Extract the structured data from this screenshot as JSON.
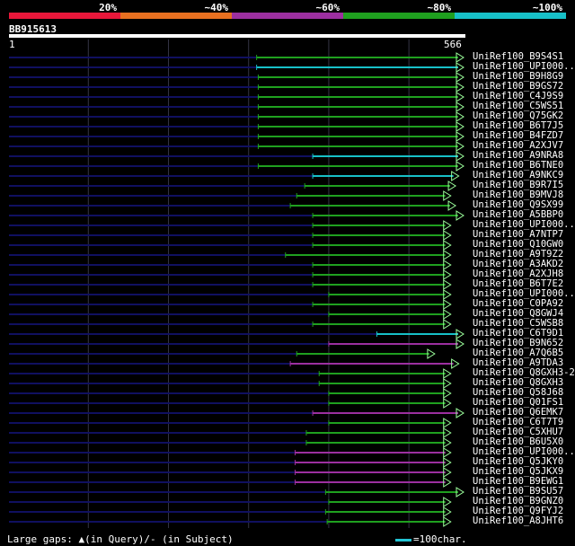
{
  "legend": [
    {
      "label": "20%",
      "color": "#e8173a"
    },
    {
      "label": "~40%",
      "color": "#e87020"
    },
    {
      "label": "~60%",
      "color": "#9c2fa0"
    },
    {
      "label": "~80%",
      "color": "#1fa01f"
    },
    {
      "label": "~100%",
      "color": "#17c0c8"
    }
  ],
  "query": {
    "id": "BB915613",
    "start": "1",
    "end": "566"
  },
  "colors": {
    "green": "#1fa01f",
    "cyan": "#17c0c8",
    "purple": "#9c2fa0",
    "navy": "#101060",
    "grid": "#333344"
  },
  "hits": [
    {
      "label": "UniRef100_B9S4S1",
      "color": "green",
      "start": 310,
      "end": 566
    },
    {
      "label": "UniRef100_UPI000..",
      "color": "cyan",
      "start": 310,
      "end": 566
    },
    {
      "label": "UniRef100_B9H8G9",
      "color": "green",
      "start": 312,
      "end": 566
    },
    {
      "label": "UniRef100_B9GS72",
      "color": "green",
      "start": 312,
      "end": 566
    },
    {
      "label": "UniRef100_C4J9S9",
      "color": "green",
      "start": 312,
      "end": 566
    },
    {
      "label": "UniRef100_C5WS51",
      "color": "green",
      "start": 312,
      "end": 566
    },
    {
      "label": "UniRef100_Q75GK2",
      "color": "green",
      "start": 312,
      "end": 566
    },
    {
      "label": "UniRef100_B6T7J5",
      "color": "green",
      "start": 312,
      "end": 566
    },
    {
      "label": "UniRef100_B4FZD7",
      "color": "green",
      "start": 312,
      "end": 566
    },
    {
      "label": "UniRef100_A2XJV7",
      "color": "green",
      "start": 312,
      "end": 566
    },
    {
      "label": "UniRef100_A9NRA8",
      "color": "cyan",
      "start": 380,
      "end": 566
    },
    {
      "label": "UniRef100_B6TNE0",
      "color": "green",
      "start": 312,
      "end": 566
    },
    {
      "label": "UniRef100_A9NKC9",
      "color": "cyan",
      "start": 380,
      "end": 560
    },
    {
      "label": "UniRef100_B9R7I5",
      "color": "green",
      "start": 370,
      "end": 556
    },
    {
      "label": "UniRef100_B9MVJ8",
      "color": "green",
      "start": 360,
      "end": 550
    },
    {
      "label": "UniRef100_Q9SX99",
      "color": "green",
      "start": 352,
      "end": 556
    },
    {
      "label": "UniRef100_A5BBP0",
      "color": "green",
      "start": 380,
      "end": 566
    },
    {
      "label": "UniRef100_UPI000..",
      "color": "green",
      "start": 380,
      "end": 550
    },
    {
      "label": "UniRef100_A7NTP7",
      "color": "green",
      "start": 380,
      "end": 550
    },
    {
      "label": "UniRef100_Q10GW0",
      "color": "green",
      "start": 380,
      "end": 550
    },
    {
      "label": "UniRef100_A9T9Z2",
      "color": "green",
      "start": 346,
      "end": 550
    },
    {
      "label": "UniRef100_A3AKD2",
      "color": "green",
      "start": 380,
      "end": 550
    },
    {
      "label": "UniRef100_A2XJH8",
      "color": "green",
      "start": 380,
      "end": 550
    },
    {
      "label": "UniRef100_B6T7E2",
      "color": "green",
      "start": 380,
      "end": 550
    },
    {
      "label": "UniRef100_UPI000..",
      "color": "green",
      "start": 400,
      "end": 550
    },
    {
      "label": "UniRef100_C0PA92",
      "color": "green",
      "start": 380,
      "end": 550
    },
    {
      "label": "UniRef100_Q8GWJ4",
      "color": "green",
      "start": 400,
      "end": 550
    },
    {
      "label": "UniRef100_C5WSB8",
      "color": "green",
      "start": 380,
      "end": 550
    },
    {
      "label": "UniRef100_C6T9D1",
      "color": "cyan",
      "start": 460,
      "end": 566
    },
    {
      "label": "UniRef100_B9N652",
      "color": "purple",
      "start": 400,
      "end": 566
    },
    {
      "label": "UniRef100_A7Q6B5",
      "color": "green",
      "start": 360,
      "end": 530
    },
    {
      "label": "UniRef100_A9TDA3",
      "color": "purple",
      "start": 352,
      "end": 560
    },
    {
      "label": "UniRef100_Q8GXH3-2",
      "color": "green",
      "start": 388,
      "end": 550
    },
    {
      "label": "UniRef100_Q8GXH3",
      "color": "green",
      "start": 388,
      "end": 550
    },
    {
      "label": "UniRef100_Q58J68",
      "color": "green",
      "start": 400,
      "end": 550
    },
    {
      "label": "UniRef100_Q01FS1",
      "color": "green",
      "start": 400,
      "end": 550
    },
    {
      "label": "UniRef100_Q6EMK7",
      "color": "purple",
      "start": 380,
      "end": 566
    },
    {
      "label": "UniRef100_C6T7T9",
      "color": "green",
      "start": 400,
      "end": 550
    },
    {
      "label": "UniRef100_C5XHU7",
      "color": "green",
      "start": 372,
      "end": 550
    },
    {
      "label": "UniRef100_B6U5X0",
      "color": "green",
      "start": 372,
      "end": 550
    },
    {
      "label": "UniRef100_UPI000..",
      "color": "purple",
      "start": 358,
      "end": 550
    },
    {
      "label": "UniRef100_Q5JKY0",
      "color": "purple",
      "start": 358,
      "end": 550
    },
    {
      "label": "UniRef100_Q5JKX9",
      "color": "purple",
      "start": 358,
      "end": 550
    },
    {
      "label": "UniRef100_B9EWG1",
      "color": "purple",
      "start": 358,
      "end": 550
    },
    {
      "label": "UniRef100_B9SU57",
      "color": "green",
      "start": 396,
      "end": 566
    },
    {
      "label": "UniRef100_B9GNZ0",
      "color": "green",
      "start": 400,
      "end": 550
    },
    {
      "label": "UniRef100_Q9FYJ2",
      "color": "green",
      "start": 396,
      "end": 550
    },
    {
      "label": "UniRef100_A8JHT6",
      "color": "green",
      "start": 398,
      "end": 550
    }
  ],
  "footer": {
    "gaps_text": "Large gaps: ▲(in Query)/- (in Subject)",
    "scale_text": "=100char."
  }
}
